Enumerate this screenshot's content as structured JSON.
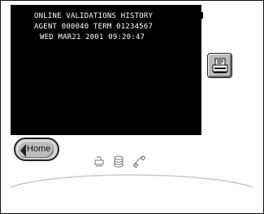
{
  "receipt": {
    "lines": [
      "ONLINE VALIDATIONS HISTORY",
      "AGENT 000040 TERM 01234567",
      "WED MAR21 2001 09:20:47"
    ]
  },
  "nav": {
    "home_label": "Home"
  },
  "icons": {
    "print": "printer-icon",
    "home_arrow": "arrow-left-icon",
    "status": [
      "printer-status-icon",
      "database-status-icon",
      "phone-status-icon"
    ]
  },
  "colors": {
    "screen": "#000000",
    "button_face": "#bcbcbc",
    "page": "#ffffff",
    "arc": "#c8c8c8"
  }
}
